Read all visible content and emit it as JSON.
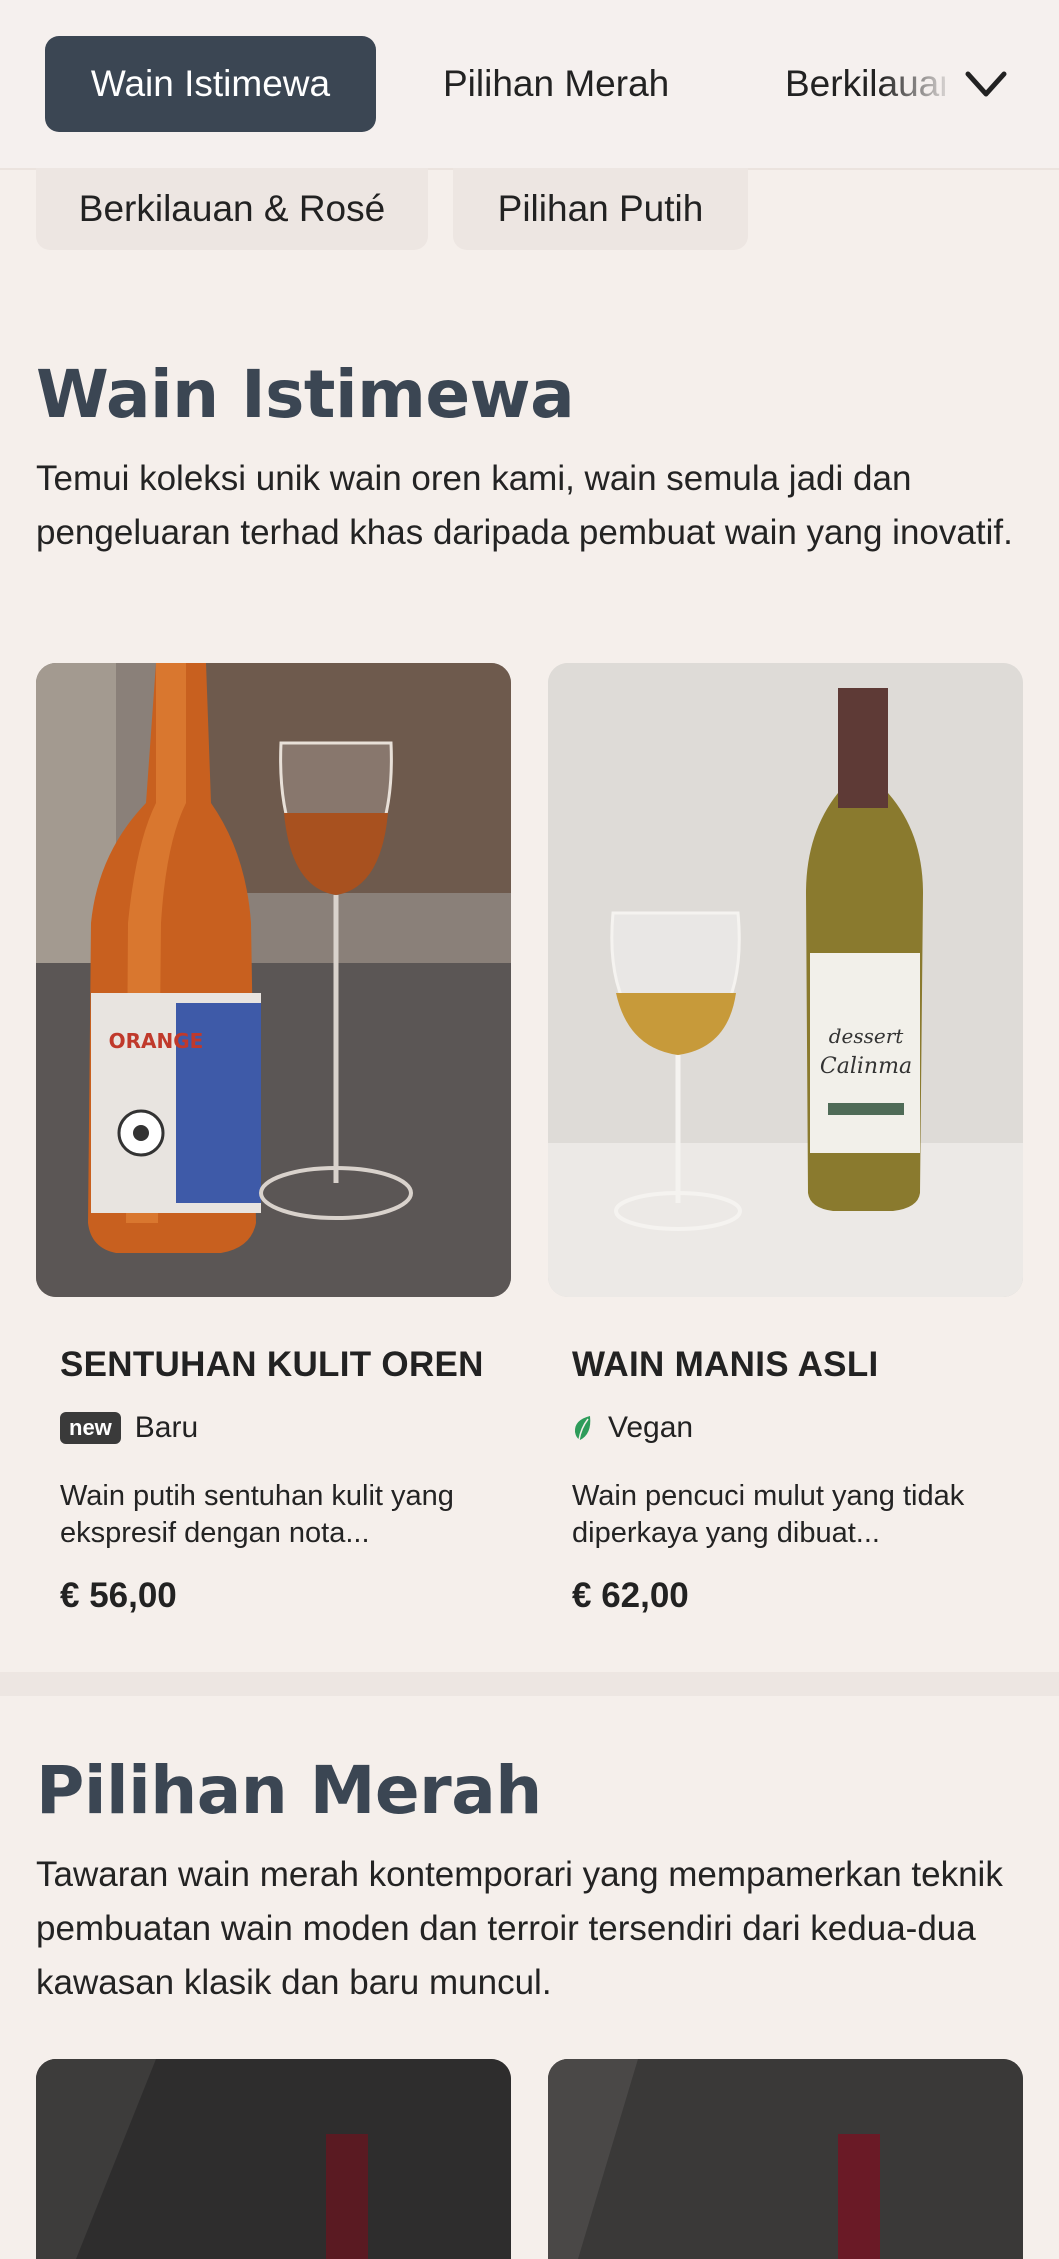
{
  "tabs": {
    "active": "Wain Istimewa",
    "items": [
      "Pilihan Merah",
      "Berkilauan & Rosé"
    ],
    "overflow": [
      "Berkilauan & Rosé",
      "Pilihan Putih"
    ]
  },
  "sections": [
    {
      "title": "Wain Istimewa",
      "description": "Temui koleksi unik wain oren kami, wain semula jadi dan pengeluaran terhad khas daripada pembuat wain yang inovatif.",
      "products": [
        {
          "name": "SENTUHAN KULIT OREN",
          "badge": "new",
          "tag": "Baru",
          "description": "Wain putih sentuhan kulit yang ekspresif dengan nota...",
          "price": "€ 56,00",
          "image_label": "ORANGE"
        },
        {
          "name": "WAIN MANIS ASLI",
          "tag": "Vegan",
          "icon": "leaf-icon",
          "description": "Wain pencuci mulut yang tidak diperkaya yang dibuat...",
          "price": "€ 62,00",
          "image_label": "dessert Calinma"
        }
      ]
    },
    {
      "title": "Pilihan Merah",
      "description": "Tawaran wain merah kontemporari yang mempamerkan teknik pembuatan wain moden dan terroir tersendiri dari kedua-dua kawasan klasik dan baru muncul."
    }
  ],
  "colors": {
    "accent": "#3b4653",
    "background": "#f5efeb",
    "vegan": "#2e9c5a"
  }
}
